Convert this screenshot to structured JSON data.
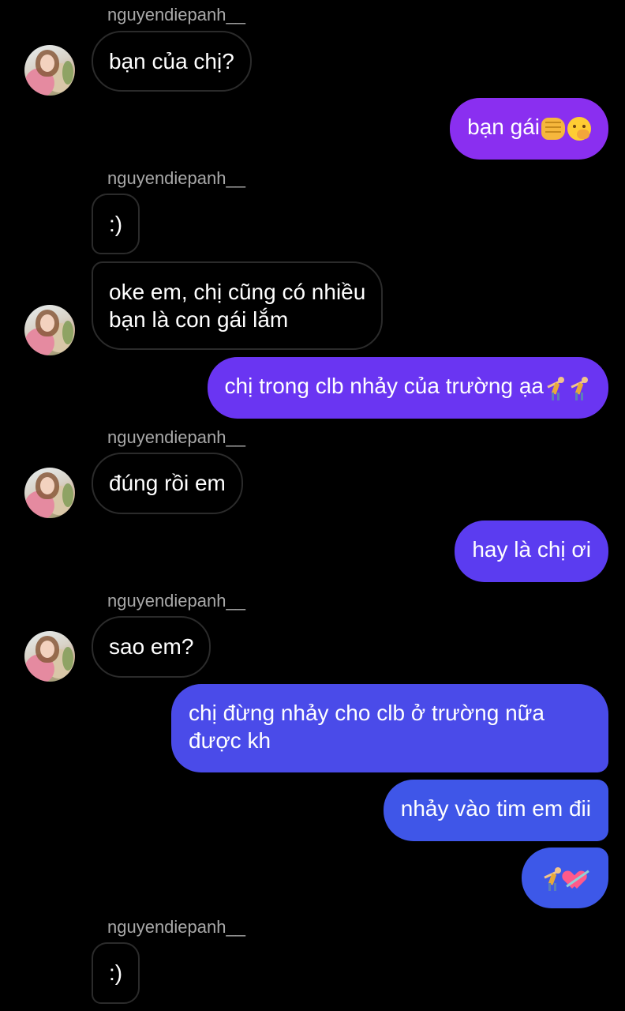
{
  "conversation": {
    "contact_username": "nguyendiepanh__",
    "messages": [
      {
        "from": "them",
        "text": "bạn của chị?"
      },
      {
        "from": "me",
        "text": "bạn gái",
        "emojis": [
          "fist-bump",
          "face-with-hand-over-mouth"
        ]
      },
      {
        "from": "them",
        "text": ":)"
      },
      {
        "from": "them",
        "lines": [
          "oke em, chị cũng có nhiều",
          "bạn là con gái lắm"
        ]
      },
      {
        "from": "me",
        "text": "chị trong clb nhảy của trường ạa",
        "emojis": [
          "cartwheel",
          "cartwheel"
        ]
      },
      {
        "from": "them",
        "text": "đúng rồi em"
      },
      {
        "from": "me",
        "text": "hay là chị ơi"
      },
      {
        "from": "them",
        "text": "sao em?"
      },
      {
        "from": "me",
        "lines": [
          "chị đừng nhảy cho clb ở trường nữa",
          "được kh"
        ]
      },
      {
        "from": "me",
        "text": "nhảy vào tim em đii"
      },
      {
        "from": "me",
        "text": "",
        "emojis": [
          "cartwheel",
          "heart-with-arrow"
        ]
      },
      {
        "from": "them",
        "text": ":)"
      }
    ]
  },
  "colors": {
    "background": "#000000",
    "incoming_border": "#2b2b2b",
    "username_gray": "#a8a8a8",
    "out_purple": "#8a2ff0",
    "out_violet": "#6a35f2",
    "out_indigo": "#5b3cf0",
    "out_blue": "#3e55e8"
  }
}
